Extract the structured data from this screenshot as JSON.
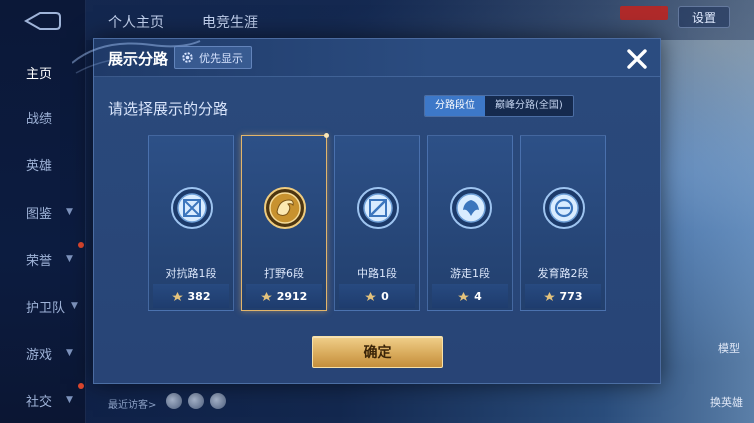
{
  "background": {
    "nav_items": [
      {
        "label": "主页",
        "active": true
      },
      {
        "label": "战绩"
      },
      {
        "label": "英雄"
      },
      {
        "label": "图鉴",
        "chevron": true
      },
      {
        "label": "荣誉",
        "chevron": true,
        "dot": true
      },
      {
        "label": "护卫队",
        "chevron": true
      },
      {
        "label": "游戏",
        "chevron": true
      },
      {
        "label": "社交",
        "chevron": true,
        "dot": true
      }
    ],
    "top_tabs": [
      "个人主页",
      "电竞生涯"
    ],
    "settings_label": "设置",
    "recent_visitors_label": "最近访客>",
    "side_labels": [
      "模型",
      "换英雄"
    ]
  },
  "modal": {
    "title": "展示分路",
    "priority_label": "优先显示",
    "subtitle": "请选择展示的分路",
    "toggle": [
      {
        "label": "分路段位",
        "active": true
      },
      {
        "label": "巅峰分路(全国)",
        "active": false
      }
    ],
    "cards": [
      {
        "rank": "对抗路1段",
        "points": "382",
        "selected": false,
        "emblem": "sword-shield-emblem-icon"
      },
      {
        "rank": "打野6段",
        "points": "2912",
        "selected": true,
        "emblem": "gold-dragon-emblem-icon"
      },
      {
        "rank": "中路1段",
        "points": "0",
        "selected": false,
        "emblem": "wand-emblem-icon"
      },
      {
        "rank": "游走1段",
        "points": "4",
        "selected": false,
        "emblem": "wing-emblem-icon"
      },
      {
        "rank": "发育路2段",
        "points": "773",
        "selected": false,
        "emblem": "target-emblem-icon"
      }
    ],
    "confirm_label": "确定"
  },
  "colors": {
    "accent_blue": "#3d78c8",
    "gold": "#e2b56b",
    "modal_bg": "#2a4a7c"
  }
}
